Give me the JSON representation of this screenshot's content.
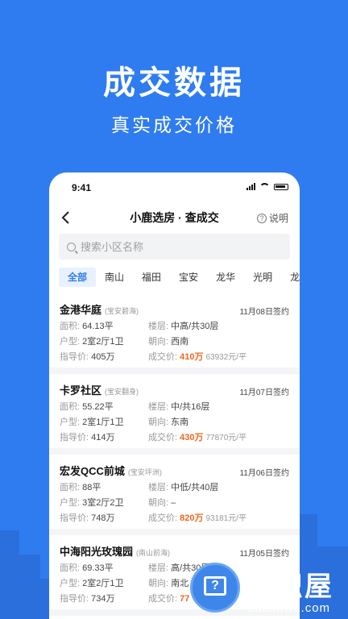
{
  "promo": {
    "title": "成交数据",
    "subtitle": "真实成交价格"
  },
  "status_bar": {
    "time": "9:41"
  },
  "nav": {
    "title": "小鹿选房 · 查成交",
    "help_label": "说明",
    "back_icon": "chevron-left-icon",
    "help_icon": "question-circle-icon"
  },
  "search": {
    "placeholder": "搜索小区名称"
  },
  "tabs": [
    "全部",
    "南山",
    "福田",
    "宝安",
    "龙华",
    "光明",
    "龙"
  ],
  "labels": {
    "area": "面积:",
    "layout": "户型:",
    "guide": "指导价:",
    "floor": "楼层:",
    "orientation": "朝向:",
    "deal": "成交价:"
  },
  "deals": [
    {
      "name": "金港华庭",
      "district": "(宝安碧海)",
      "date": "11月08日签约",
      "area": "64.13平",
      "floor": "中高/共30层",
      "layout": "2室2厅1卫",
      "orientation": "西南",
      "guide_price": "405万",
      "deal_price": "410万",
      "unit_price": "63932元/平"
    },
    {
      "name": "卡罗社区",
      "district": "(宝安翻身)",
      "date": "11月07日签约",
      "area": "55.22平",
      "floor": "中/共16层",
      "layout": "2室1厅1卫",
      "orientation": "东南",
      "guide_price": "414万",
      "deal_price": "430万",
      "unit_price": "77870元/平"
    },
    {
      "name": "宏发QCC前城",
      "district": "(宝安坪洲)",
      "date": "11月06日签约",
      "area": "88平",
      "floor": "中低/共40层",
      "layout": "3室2厅2卫",
      "orientation": "–",
      "guide_price": "748万",
      "deal_price": "820万",
      "unit_price": "93181元/平"
    },
    {
      "name": "中海阳光玫瑰园",
      "district": "(南山前海)",
      "date": "11月05日签约",
      "area": "69.33平",
      "floor": "高/共30层",
      "layout": "2室2厅1卫",
      "orientation": "南北",
      "guide_price": "734万",
      "deal_price": "77",
      "unit_price": ""
    }
  ],
  "watermark": {
    "text": "知识屋",
    "url": "zhishiwu.com"
  },
  "colors": {
    "background": "#2f7cf0",
    "accent": "#2f7cf0",
    "price": "#f0661e"
  }
}
